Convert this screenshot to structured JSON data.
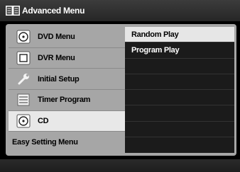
{
  "window": {
    "title": "Advanced Menu"
  },
  "menu": {
    "items": [
      {
        "label": "DVD Menu",
        "icon": "disc-icon",
        "selected": false
      },
      {
        "label": "DVR Menu",
        "icon": "square-icon",
        "selected": false
      },
      {
        "label": "Initial Setup",
        "icon": "wrench-icon",
        "selected": false
      },
      {
        "label": "Timer Program",
        "icon": "list-icon",
        "selected": false
      },
      {
        "label": "CD",
        "icon": "disc-icon",
        "selected": true
      },
      {
        "label": "Easy Setting Menu",
        "icon": "",
        "selected": false
      }
    ]
  },
  "submenu": {
    "items": [
      {
        "label": "Random Play",
        "highlighted": true
      },
      {
        "label": "Program Play",
        "highlighted": false
      }
    ]
  },
  "colors": {
    "panel": "#a6a6a6",
    "selected_item": "#e8e8e8",
    "submenu_bg": "#1b1b1b",
    "submenu_highlight": "#e6e6e6"
  }
}
